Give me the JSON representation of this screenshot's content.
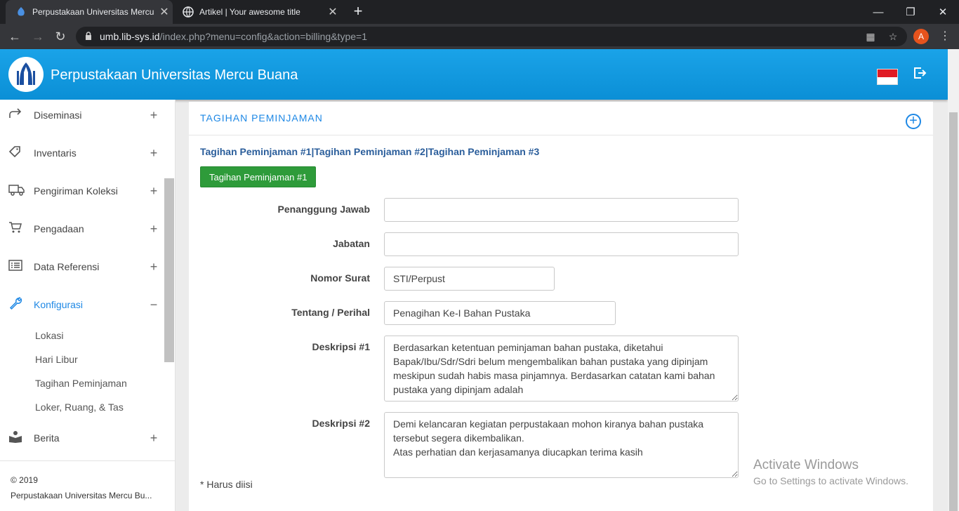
{
  "browser": {
    "tabs": [
      {
        "title": "Perpustakaan Universitas Mercu B"
      },
      {
        "title": "Artikel | Your awesome title"
      }
    ],
    "url_host": "umb.lib-sys.id",
    "url_path": "/index.php?menu=config&action=billing&type=1",
    "profile_initial": "A",
    "new_tab": "+"
  },
  "header": {
    "title": "Perpustakaan Universitas Mercu Buana"
  },
  "sidebar": {
    "items": [
      {
        "label": "Diseminasi",
        "toggle": "+"
      },
      {
        "label": "Inventaris",
        "toggle": "+"
      },
      {
        "label": "Pengiriman Koleksi",
        "toggle": "+"
      },
      {
        "label": "Pengadaan",
        "toggle": "+"
      },
      {
        "label": "Data Referensi",
        "toggle": "+"
      },
      {
        "label": "Konfigurasi",
        "toggle": "−"
      },
      {
        "label": "Berita",
        "toggle": "+"
      }
    ],
    "subitems": [
      "Lokasi",
      "Hari Libur",
      "Tagihan Peminjaman",
      "Loker, Ruang, & Tas"
    ],
    "footer_year": "© 2019",
    "footer_name": "Perpustakaan Universitas Mercu Bu..."
  },
  "main": {
    "card_title": "TAGIHAN PEMINJAMAN",
    "links": [
      "Tagihan Peminjaman #1",
      "Tagihan Peminjaman #2",
      "Tagihan Peminjaman #3"
    ],
    "separator": "|",
    "active_button": "Tagihan Peminjaman #1",
    "form": {
      "penanggung_jawab_label": "Penanggung Jawab",
      "penanggung_jawab_value": "",
      "jabatan_label": "Jabatan",
      "jabatan_value": "",
      "nomor_surat_label": "Nomor Surat",
      "nomor_surat_value": "STI/Perpust",
      "tentang_label": "Tentang / Perihal",
      "tentang_value": "Penagihan Ke-I Bahan Pustaka",
      "deskripsi1_label": "Deskripsi #1",
      "deskripsi1_value": "Berdasarkan ketentuan peminjaman bahan pustaka, diketahui Bapak/Ibu/Sdr/Sdri belum mengembalikan bahan pustaka yang dipinjam meskipun sudah habis masa pinjamnya. Berdasarkan catatan kami bahan pustaka yang dipinjam adalah",
      "deskripsi2_label": "Deskripsi #2",
      "deskripsi2_value": "Demi kelancaran kegiatan perpustakaan mohon kiranya bahan pustaka tersebut segera dikembalikan.\nAtas perhatian dan kerjasamanya diucapkan terima kasih"
    },
    "required_note": "* Harus diisi"
  },
  "watermark": {
    "line1": "Activate Windows",
    "line2": "Go to Settings to activate Windows."
  },
  "colors": {
    "header": "#0b8fd6",
    "accent": "#1e88e5",
    "button_green": "#2e9b3a"
  }
}
